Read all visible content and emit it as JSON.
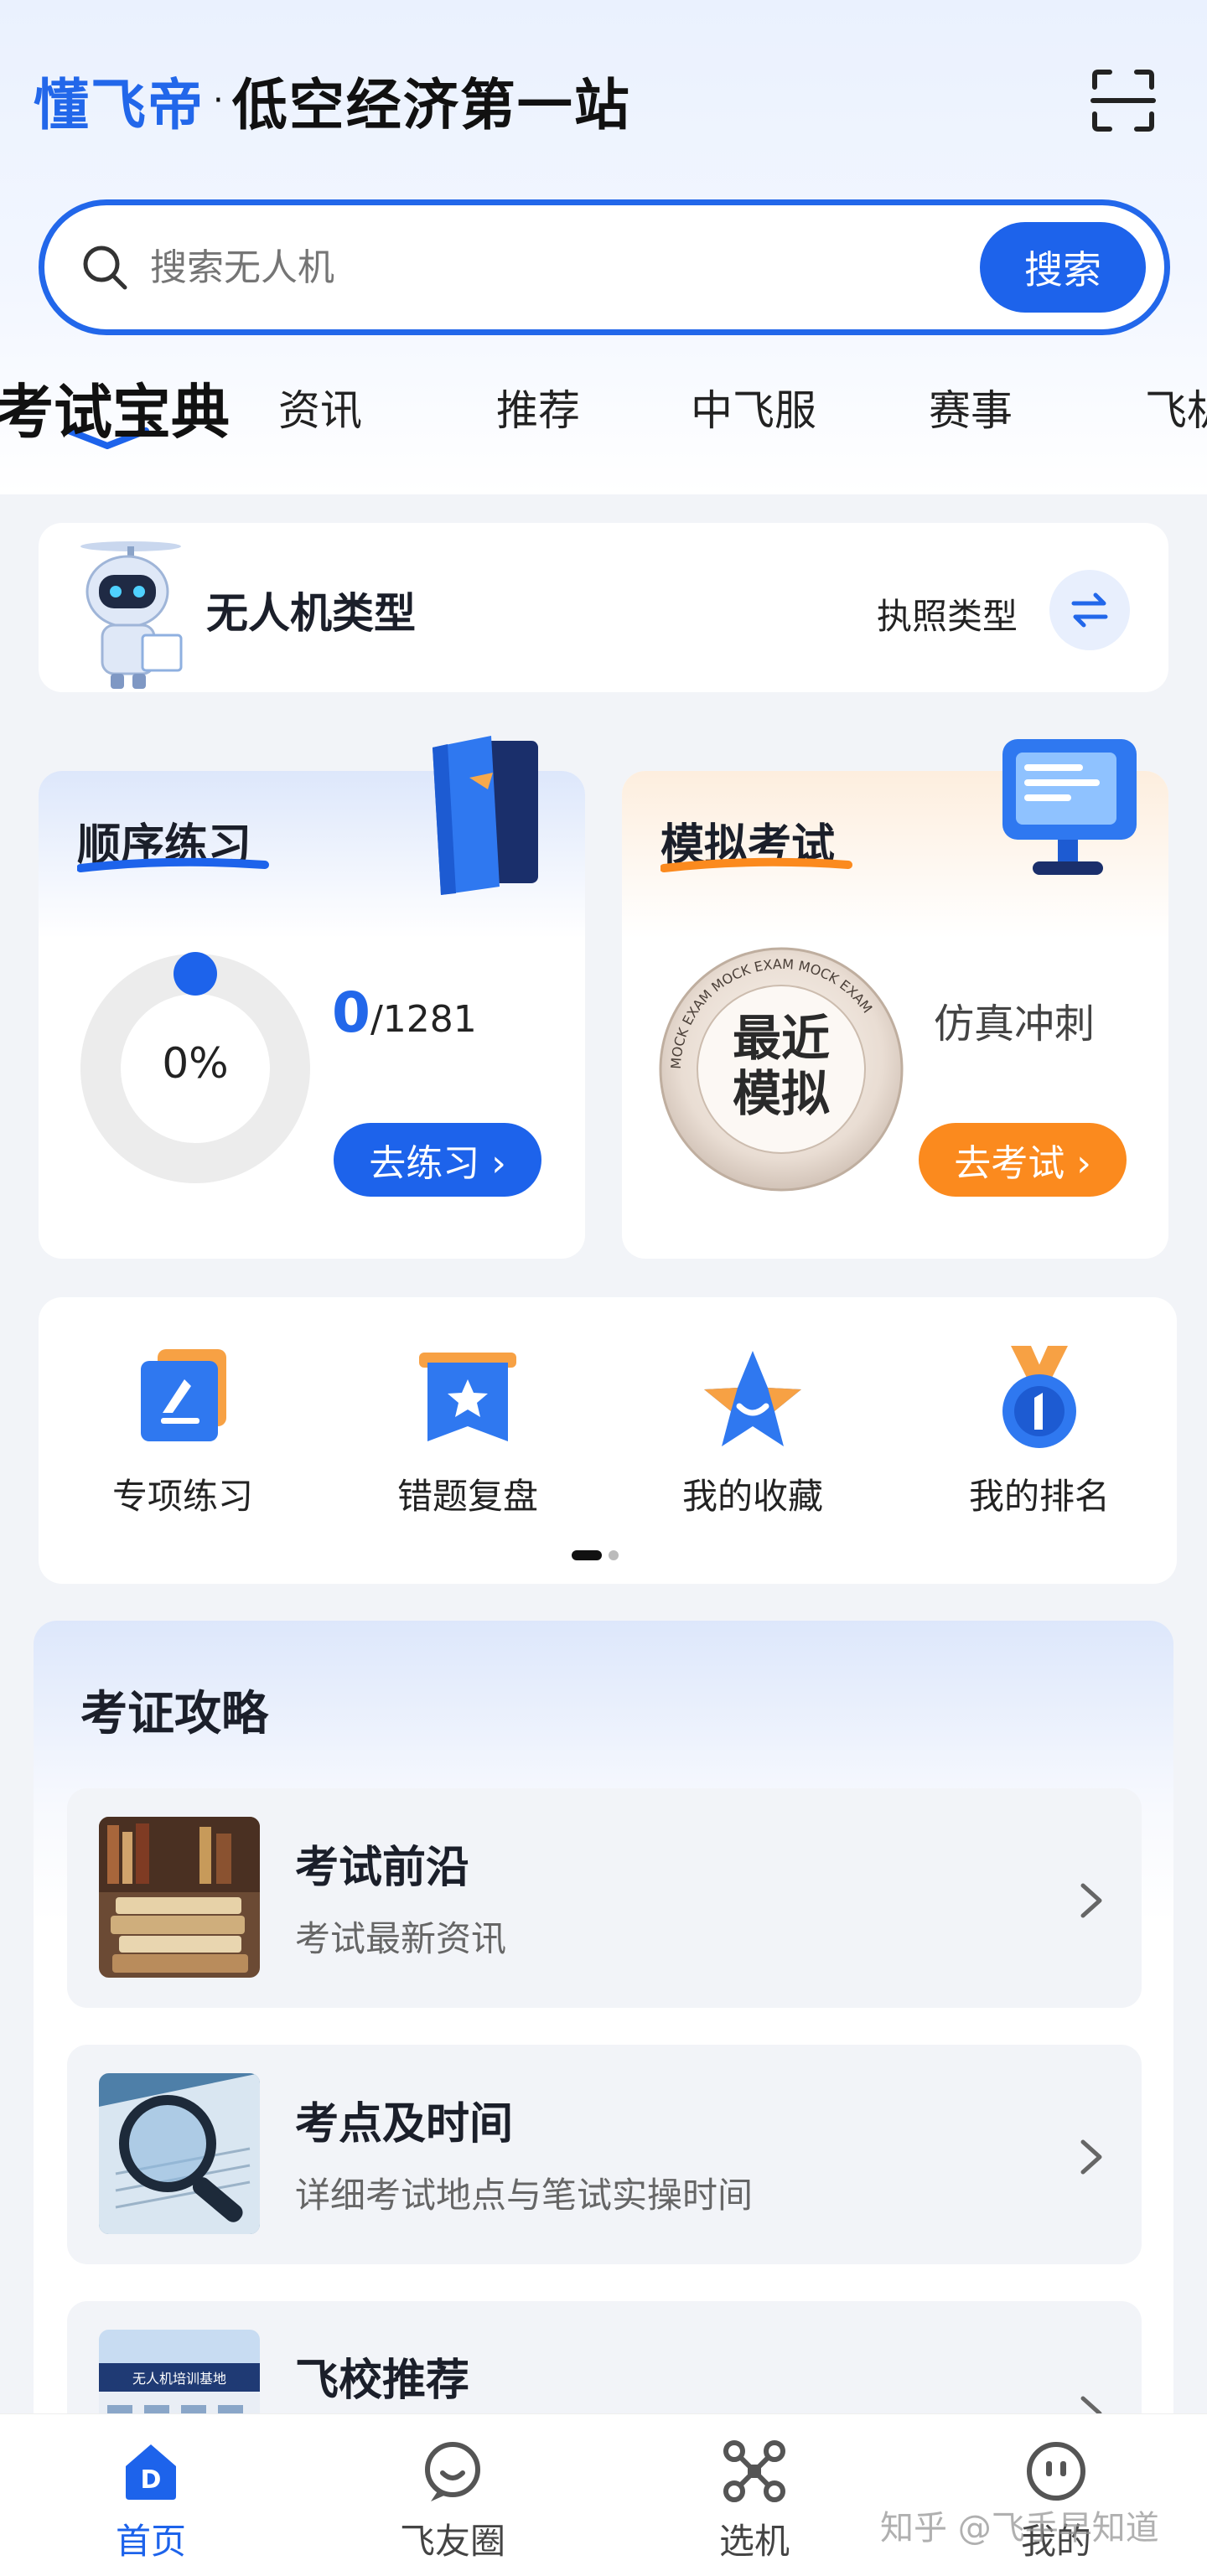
{
  "header": {
    "brand": "懂飞帝",
    "separator": "·",
    "subtitle": "低空经济第一站"
  },
  "search": {
    "placeholder": "搜索无人机",
    "button_label": "搜索"
  },
  "tabs": [
    {
      "label": "考试宝典",
      "active": true
    },
    {
      "label": "资讯"
    },
    {
      "label": "推荐"
    },
    {
      "label": "中飞服"
    },
    {
      "label": "赛事"
    },
    {
      "label": "飞机"
    }
  ],
  "drone_card": {
    "title": "无人机类型",
    "license_label": "执照类型"
  },
  "practice": {
    "title": "顺序练习",
    "progress_text": "0%",
    "progress_fraction": 0,
    "done": "0",
    "total_text": "/1281",
    "button_label": "去练习 ›"
  },
  "exam": {
    "title": "模拟考试",
    "seal_line1": "最近",
    "seal_line2": "模拟",
    "seal_ring_text": "MOCK EXAM MOCK EXAM MOCK EXAM",
    "label": "仿真冲刺",
    "button_label": "去考试 ›"
  },
  "quick_actions": [
    {
      "label": "专项练习",
      "icon": "pen-doc-icon"
    },
    {
      "label": "错题复盘",
      "icon": "star-bookmark-icon"
    },
    {
      "label": "我的收藏",
      "icon": "star-icon"
    },
    {
      "label": "我的排名",
      "icon": "medal-icon"
    }
  ],
  "guide": {
    "title": "考证攻略",
    "items": [
      {
        "title": "考试前沿",
        "subtitle": "考试最新资讯",
        "thumb": "books-thumb"
      },
      {
        "title": "考点及时间",
        "subtitle": "详细考试地点与笔试实操时间",
        "thumb": "magnifier-thumb"
      },
      {
        "title": "飞校推荐",
        "subtitle": "",
        "thumb": "school-thumb",
        "thumb_text": "无人机培训基地"
      }
    ]
  },
  "bottom_nav": [
    {
      "label": "首页",
      "active": true,
      "icon": "home-icon"
    },
    {
      "label": "飞友圈",
      "icon": "chat-icon"
    },
    {
      "label": "选机",
      "icon": "drone-icon"
    },
    {
      "label": "我的",
      "icon": "profile-icon"
    }
  ],
  "watermark": "知乎 @飞手早知道",
  "colors": {
    "primary": "#1d63eb",
    "accent_orange": "#fb8a1e",
    "background": "#f2f4f8"
  }
}
